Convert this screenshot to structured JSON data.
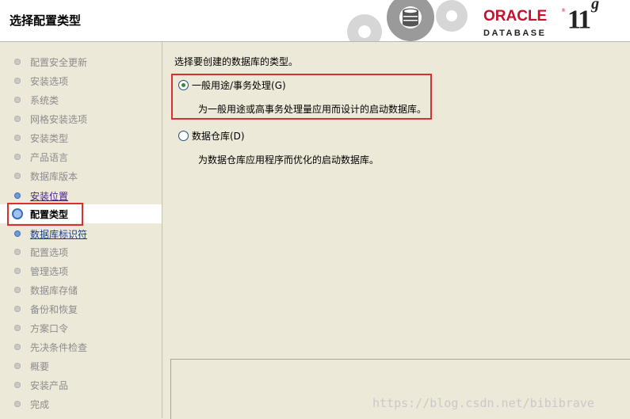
{
  "header": {
    "title": "选择配置类型",
    "brand": "ORACLE",
    "brand_mark": "®",
    "product": "DATABASE",
    "version_main": "11",
    "version_suffix": "g"
  },
  "sidebar": {
    "items": [
      {
        "label": "配置安全更新",
        "state": "disabled"
      },
      {
        "label": "安装选项",
        "state": "disabled"
      },
      {
        "label": "系统类",
        "state": "disabled"
      },
      {
        "label": "网格安装选项",
        "state": "disabled"
      },
      {
        "label": "安装类型",
        "state": "disabled"
      },
      {
        "label": "产品语言",
        "state": "disabled"
      },
      {
        "label": "数据库版本",
        "state": "disabled"
      },
      {
        "label": "安装位置",
        "state": "visited"
      },
      {
        "label": "配置类型",
        "state": "current"
      },
      {
        "label": "数据库标识符",
        "state": "link"
      },
      {
        "label": "配置选项",
        "state": "disabled"
      },
      {
        "label": "管理选项",
        "state": "disabled"
      },
      {
        "label": "数据库存储",
        "state": "disabled"
      },
      {
        "label": "备份和恢复",
        "state": "disabled"
      },
      {
        "label": "方案口令",
        "state": "disabled"
      },
      {
        "label": "先决条件检查",
        "state": "disabled"
      },
      {
        "label": "概要",
        "state": "disabled"
      },
      {
        "label": "安装产品",
        "state": "disabled"
      },
      {
        "label": "完成",
        "state": "disabled"
      }
    ]
  },
  "main": {
    "prompt": "选择要创建的数据库的类型。",
    "options": [
      {
        "label": "一般用途/事务处理(G)",
        "description": "为一般用途或高事务处理量应用而设计的启动数据库。",
        "checked": true
      },
      {
        "label": "数据仓库(D)",
        "description": "为数据仓库应用程序而优化的启动数据库。",
        "checked": false
      }
    ]
  },
  "watermark": "https://blog.csdn.net/bibibrave",
  "colors": {
    "oracle_red": "#c8102e",
    "highlight_red": "#d9302f",
    "background": "#ece9d8"
  }
}
